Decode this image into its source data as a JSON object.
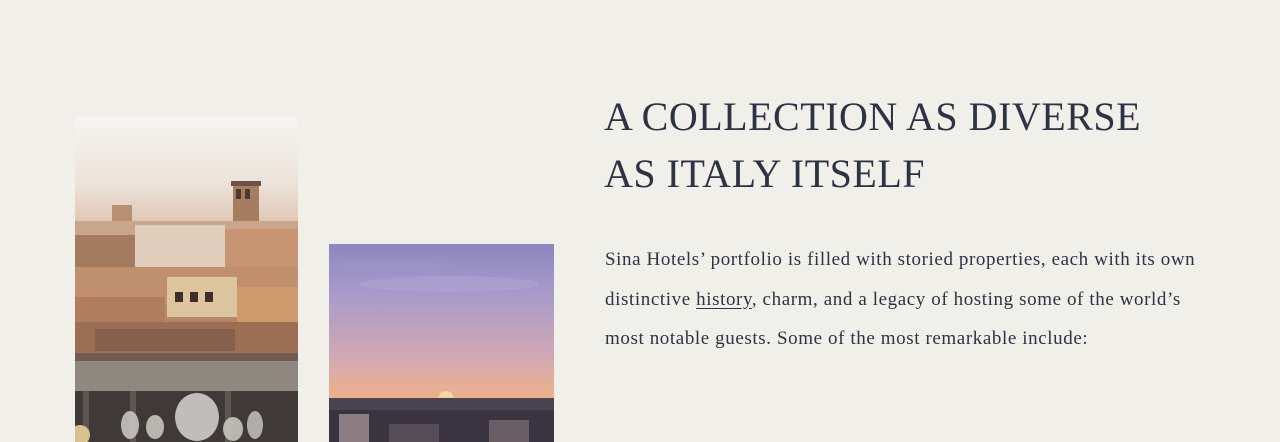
{
  "section": {
    "heading_line1": "A COLLECTION AS DIVERSE",
    "heading_line2": "AS ITALY ITSELF",
    "body_before_link": "Sina Hotels’ portfolio is filled with storied properties, each with its own distinctive ",
    "link_text": "history",
    "body_after_link": ", charm, and a legacy of hosting some of the world’s most notable guests. Some of the most remarkable include:"
  },
  "images": {
    "town_photo": "hilltop-town-rooftops-photo",
    "rome_photo": "rome-dusk-skyline-photo"
  },
  "colors": {
    "background": "#f0efea",
    "text": "#2d3342"
  }
}
